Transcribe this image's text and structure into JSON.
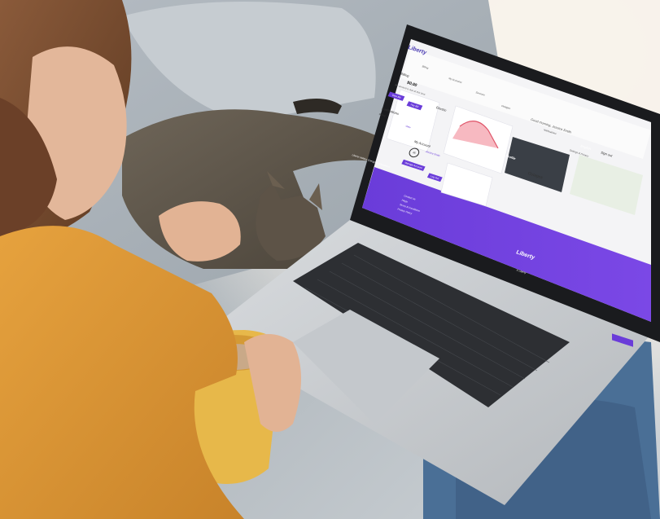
{
  "brand": {
    "name": "Liberty",
    "footer_name": "Liberty"
  },
  "nav": {
    "items": [
      "Billing",
      "My Accounts",
      "Services",
      "Outages",
      "Notifications",
      "Settings & Privacy"
    ],
    "greeting": "Good morning, Jessica Smith",
    "language": "English",
    "signout": "Sign out"
  },
  "billing": {
    "title": "Billing",
    "amount": "$0.00",
    "due_text": "No amount is due at this time",
    "btn_view": "View Bill",
    "btn_pay": "Pay Bill"
  },
  "notifications": {
    "title": "Notifications",
    "row_label": "Billing",
    "row_action": "View"
  },
  "electric": {
    "title": "Electric"
  },
  "my_account": {
    "title": "My Account",
    "avatar_initials": "JS",
    "name": "Jessica Smith",
    "manage_label": "Manage Account",
    "logout_label": "Log Out"
  },
  "promo": {
    "text": "Your Home's Energy Profile"
  },
  "outages": {
    "title": "Outages"
  },
  "footer": {
    "address": "Liberty Utilities Energy Headquarters",
    "links": [
      "Contact Us",
      "FAQs",
      "Terms & Conditions",
      "Privacy Policy"
    ],
    "copyright": "© Liberty"
  },
  "colors": {
    "accent": "#6a3cd9",
    "accent_dark": "#5a2fc7",
    "chart_line": "#e0566a",
    "chart_fill": "#f5a7b2"
  }
}
